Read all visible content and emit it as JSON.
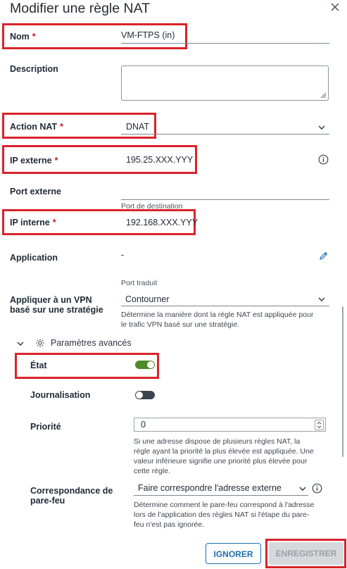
{
  "dialog": {
    "title": "Modifier une règle NAT"
  },
  "fields": {
    "nom": {
      "label": "Nom",
      "required": "*",
      "value": "VM-FTPS (in)"
    },
    "description": {
      "label": "Description",
      "value": ""
    },
    "action_nat": {
      "label": "Action NAT",
      "required": "*",
      "value": "DNAT"
    },
    "ip_externe": {
      "label": "IP externe",
      "required": "*",
      "value": "195.25.XXX.YYY"
    },
    "port_externe": {
      "label": "Port externe",
      "value": "",
      "hint": "Port de destination"
    },
    "ip_interne": {
      "label": "IP interne",
      "required": "*",
      "value": "192.168.XXX.YYY"
    },
    "application": {
      "label": "Application",
      "value": "-",
      "hint": "Port traduit"
    },
    "vpn": {
      "label_line1": "Appliquer à un VPN",
      "label_line2": "basé sur une stratégie",
      "value": "Contourner",
      "help_line1": "Détermine la manière dont la règle NAT est appliquée pour",
      "help_line2": "le trafic VPN basé sur une stratégie."
    }
  },
  "advanced": {
    "title": "Paramètres avancés",
    "etat": {
      "label": "État",
      "on": true
    },
    "journalisation": {
      "label": "Journalisation",
      "on": false
    },
    "priorite": {
      "label": "Priorité",
      "value": "0",
      "help_line1": "Si une adresse dispose de plusieurs règles NAT, la",
      "help_line2": "règle ayant la priorité la plus élevée est appliquée. Une",
      "help_line3": "valeur inférieure signifie une priorité plus élevée pour",
      "help_line4": "cette règle."
    },
    "pare_feu": {
      "label_line1": "Correspondance de",
      "label_line2": "pare-feu",
      "value": "Faire correspondre l'adresse externe",
      "help_line1": "Détermine comment le pare-feu correspond à l'adresse",
      "help_line2": "lors de l'application des règles NAT si l'étape du pare-",
      "help_line3": "feu n'est pas ignorée."
    }
  },
  "buttons": {
    "ignore": "IGNORER",
    "save": "ENREGISTRER"
  },
  "colors": {
    "accent": "#1e6fb3",
    "toggle_on": "#4d8a2a",
    "toggle_off": "#3a4550",
    "highlight": "#d9242a",
    "required": "#c81922"
  },
  "icons": {
    "close": "close-icon",
    "info": "info-icon",
    "edit": "pencil-icon",
    "settings": "gear-icon",
    "expand": "chevron-down-icon"
  }
}
